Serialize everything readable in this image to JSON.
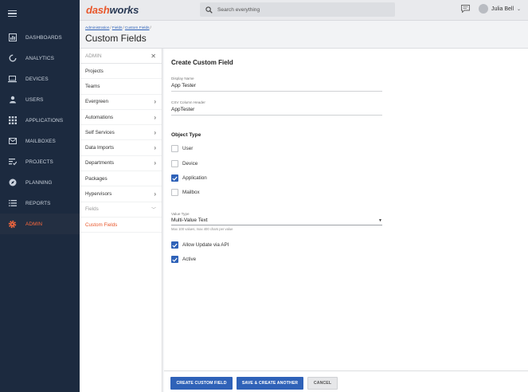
{
  "nav": {
    "items": [
      {
        "label": "DASHBOARDS",
        "icon": "dashboard-icon"
      },
      {
        "label": "ANALYTICS",
        "icon": "analytics-icon"
      },
      {
        "label": "DEVICES",
        "icon": "laptop-icon"
      },
      {
        "label": "USERS",
        "icon": "user-icon"
      },
      {
        "label": "APPLICATIONS",
        "icon": "grid-icon"
      },
      {
        "label": "MAILBOXES",
        "icon": "mail-icon"
      },
      {
        "label": "PROJECTS",
        "icon": "projects-icon"
      },
      {
        "label": "PLANNING",
        "icon": "compass-icon"
      },
      {
        "label": "REPORTS",
        "icon": "list-icon"
      },
      {
        "label": "ADMIN",
        "icon": "gear-icon"
      }
    ],
    "active_color": "#ff6a3d"
  },
  "header": {
    "logo_part1": "dash",
    "logo_part2": "works",
    "search_placeholder": "Search everything",
    "user_name": "Julia Bell"
  },
  "breadcrumb": {
    "items": [
      "Administration",
      "Fields",
      "Custom Fields"
    ],
    "separator": "/"
  },
  "page_title": "Custom Fields",
  "submenu": {
    "title": "ADMIN",
    "items": [
      {
        "label": "Projects",
        "chevron": false
      },
      {
        "label": "Teams",
        "chevron": false
      },
      {
        "label": "Evergreen",
        "chevron": true
      },
      {
        "label": "Automations",
        "chevron": true
      },
      {
        "label": "Self Services",
        "chevron": true
      },
      {
        "label": "Data Imports",
        "chevron": true
      },
      {
        "label": "Departments",
        "chevron": true
      },
      {
        "label": "Packages",
        "chevron": false
      },
      {
        "label": "Hypervisors",
        "chevron": true
      },
      {
        "label": "Fields",
        "chevron": "down"
      },
      {
        "label": "Custom Fields",
        "chevron": false
      }
    ]
  },
  "form": {
    "title": "Create Custom Field",
    "display_name": {
      "label": "Display Name",
      "value": "App Tester"
    },
    "csv_header": {
      "label": "CSV Column Header",
      "value": "AppTester"
    },
    "object_type": {
      "title": "Object Type",
      "options": [
        {
          "label": "User",
          "checked": false
        },
        {
          "label": "Device",
          "checked": false
        },
        {
          "label": "Application",
          "checked": true
        },
        {
          "label": "Mailbox",
          "checked": false
        }
      ]
    },
    "value_type": {
      "label": "Value Type",
      "value": "Multi-Value Text",
      "hint": "Max 100 values, max 400 chars per value"
    },
    "allow_update": {
      "label": "Allow Update via API",
      "checked": true
    },
    "active": {
      "label": "Active",
      "checked": true
    }
  },
  "buttons": {
    "create": "CREATE CUSTOM FIELD",
    "save_another": "SAVE & CREATE ANOTHER",
    "cancel": "CANCEL"
  },
  "colors": {
    "primary": "#2f62b8",
    "accent": "#e8572b",
    "nav_bg": "#1c2a3f"
  }
}
